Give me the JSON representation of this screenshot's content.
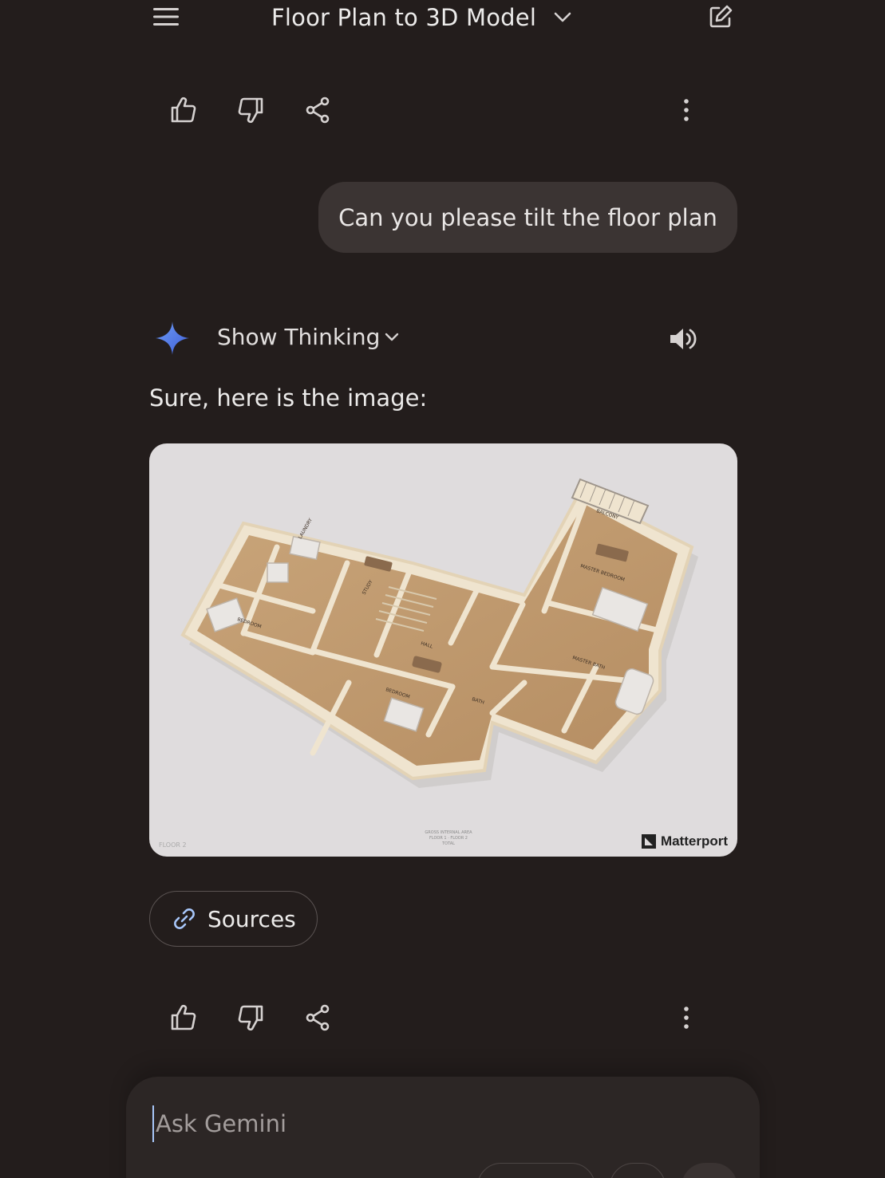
{
  "header": {
    "title": "Floor Plan to 3D Model",
    "menu_icon": "hamburger-menu-icon",
    "new_chat_icon": "edit-icon"
  },
  "user_message": {
    "text": "Can you please tilt the floor plan"
  },
  "response": {
    "show_thinking_label": "Show Thinking",
    "text": "Sure, here is the image:",
    "image": {
      "brand": "Matterport",
      "floor_tag": "FLOOR 2",
      "rooms": [
        "BALCONY",
        "MASTER BEDROOM",
        "MASTER BATH",
        "LAUNDRY",
        "STUDY",
        "BEDROOM",
        "BEDROOM",
        "HALL",
        "BATH"
      ]
    },
    "sources_label": "Sources"
  },
  "composer": {
    "placeholder": "Ask Gemini"
  },
  "colors": {
    "background": "#231d1c",
    "bubble": "#3b3433",
    "gemini_star": "#4c7ae6",
    "image_bg": "#dfdcdd"
  }
}
